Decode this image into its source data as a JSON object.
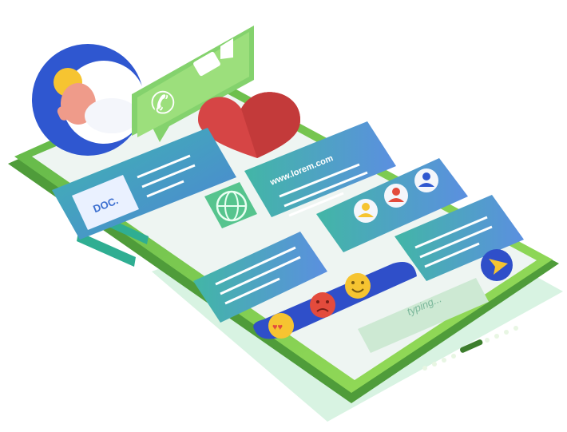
{
  "illustration": {
    "doc_label": "DOC.",
    "url_text": "www.lorem.com",
    "input_placeholder": "typing...",
    "emoji_names": [
      "love-struck-face-icon",
      "angry-face-icon",
      "smiling-face-icon"
    ],
    "colors": {
      "phone_green": "#8ed84a",
      "phone_dark_green": "#4f9c3a",
      "screen": "#eef5f2",
      "blue_card": "#4d82d6",
      "teal_card": "#3fb7b0",
      "heart_red": "#d64545",
      "emoji_yellow": "#f6c431",
      "emoji_red": "#e34b3c",
      "send_blue": "#2f4fc9",
      "shadow_mint": "#cdeed8"
    }
  }
}
